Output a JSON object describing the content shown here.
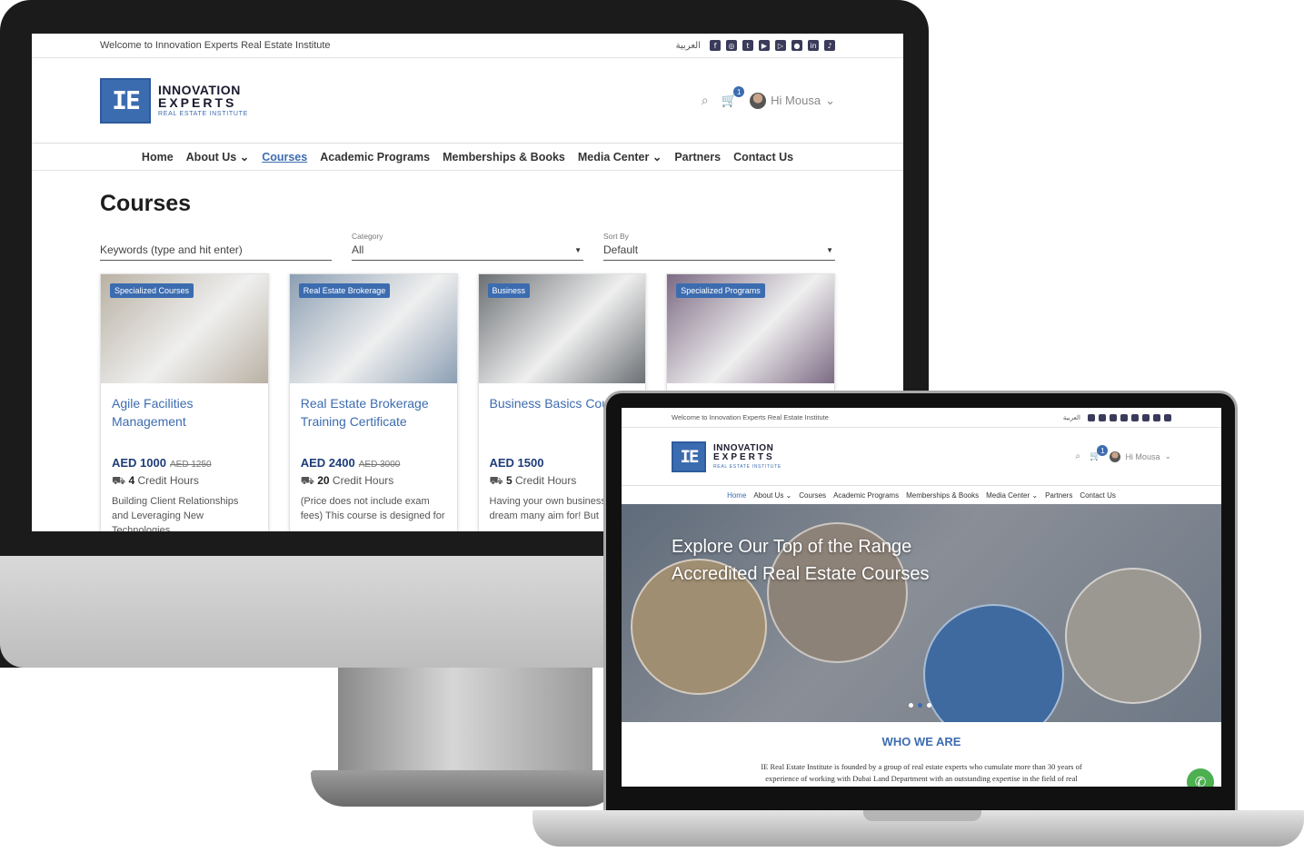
{
  "desktop": {
    "topbar": {
      "welcome": "Welcome to Innovation Experts Real Estate Institute",
      "arabic": "العربية"
    },
    "logo": {
      "line1": "INNOVATION",
      "line2": "EXPERTS",
      "line3": "REAL ESTATE INSTITUTE",
      "mark": "IE"
    },
    "user": {
      "greeting": "Hi Mousa",
      "cart_count": "1"
    },
    "nav": [
      "Home",
      "About Us",
      "Courses",
      "Academic Programs",
      "Memberships & Books",
      "Media Center",
      "Partners",
      "Contact Us"
    ],
    "page_title": "Courses",
    "filters": {
      "keyword_placeholder": "Keywords (type and hit enter)",
      "category_label": "Category",
      "category_value": "All",
      "sort_label": "Sort By",
      "sort_value": "Default"
    },
    "cards": [
      {
        "tag": "Specialized Courses",
        "title": "Agile Facilities Management",
        "price": "AED 1000",
        "old_price": "AED 1250",
        "hours_num": "4",
        "hours_label": "Credit Hours",
        "desc": "Building Client Relationships and Leveraging New Technologies",
        "color": "#b9b1a3"
      },
      {
        "tag": "Real Estate Brokerage",
        "title": "Real Estate Brokerage Training Certificate",
        "price": "AED 2400",
        "old_price": "AED 3000",
        "hours_num": "20",
        "hours_label": "Credit Hours",
        "desc": "(Price does not include exam fees) This course is designed for",
        "color": "#8c9fb3"
      },
      {
        "tag": "Business",
        "title": "Business Basics Cou",
        "price": "AED 1500",
        "old_price": "",
        "hours_num": "5",
        "hours_label": "Credit Hours",
        "desc": "Having your own business dream many aim for! But",
        "color": "#6b6f73"
      },
      {
        "tag": "Specialized Programs",
        "title": "",
        "price": "",
        "old_price": "",
        "hours_num": "",
        "hours_label": "",
        "desc": "",
        "color": "#7c6a84"
      }
    ]
  },
  "laptop": {
    "topbar": {
      "welcome": "Welcome to Innovation Experts Real Estate Institute",
      "arabic": "العربية"
    },
    "logo": {
      "line1": "INNOVATION",
      "line2": "EXPERTS",
      "line3": "REAL ESTATE INSTITUTE",
      "mark": "IE"
    },
    "user": {
      "greeting": "Hi Mousa",
      "cart_count": "1"
    },
    "nav": [
      "Home",
      "About Us",
      "Courses",
      "Academic Programs",
      "Memberships & Books",
      "Media Center",
      "Partners",
      "Contact Us"
    ],
    "hero_line1": "Explore Our Top of the Range",
    "hero_line2": "Accredited Real Estate Courses",
    "who_title": "WHO WE ARE",
    "who_text": "IE Real Estate Institute is founded by a group of real estate experts who cumulate more than 30 years of experience of working with Dubai Land Department with an outstanding expertise in the field of real"
  },
  "colors": {
    "brand": "#3c6cb0",
    "whatsapp": "#4caf50"
  }
}
